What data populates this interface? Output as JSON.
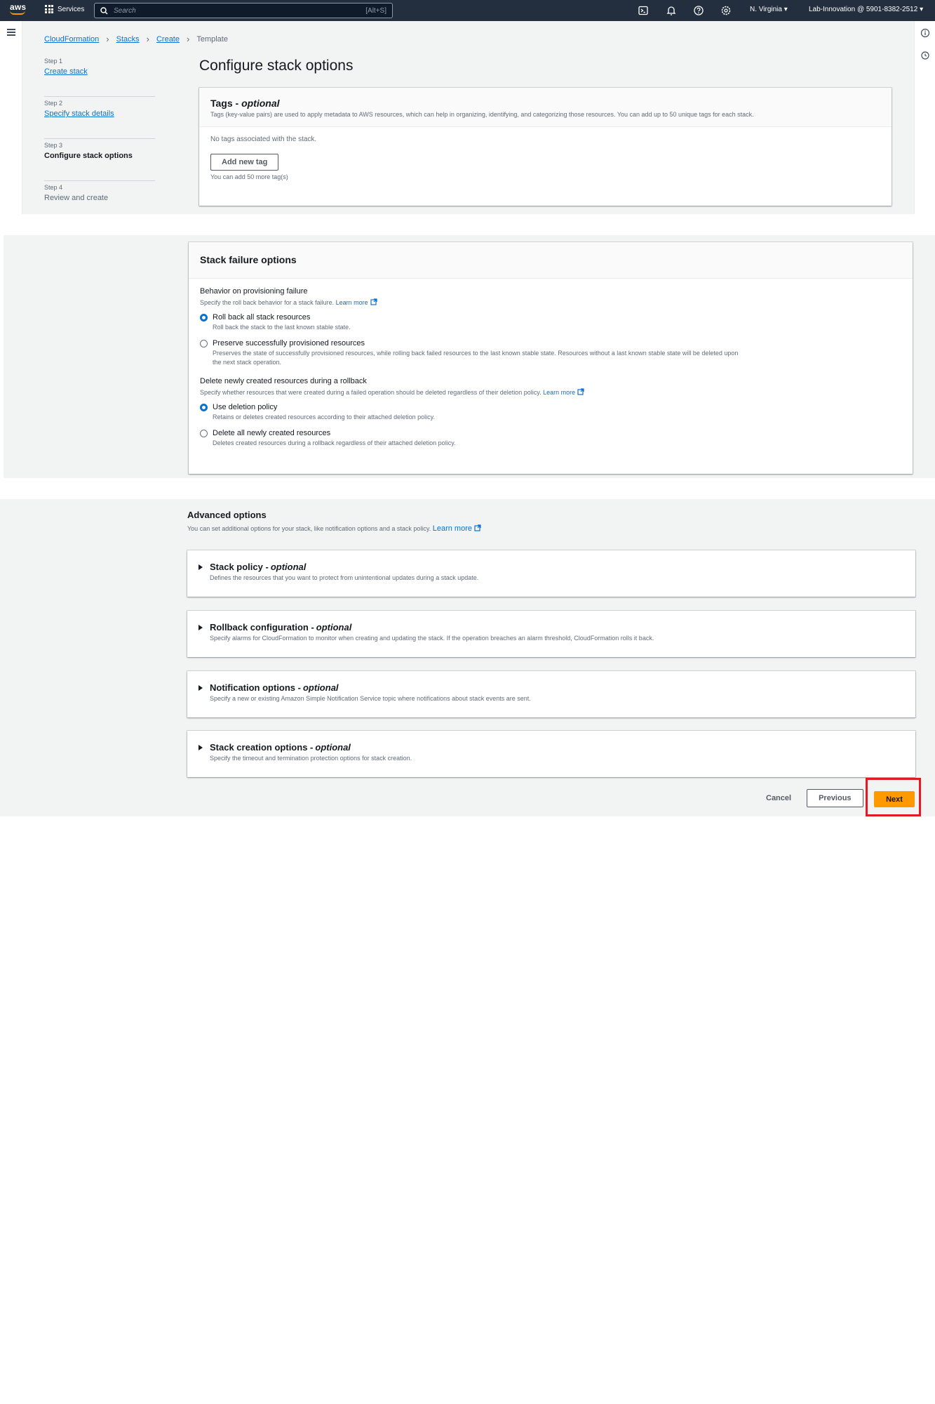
{
  "topnav": {
    "logo_text": "aws",
    "services_label": "Services",
    "search_placeholder": "Search",
    "search_shortcut": "[Alt+S]",
    "region": "N. Virginia",
    "account": "Lab-Innovation @ 5901-8382-2512"
  },
  "breadcrumbs": [
    "CloudFormation",
    "Stacks",
    "Create",
    "Template"
  ],
  "steps": [
    {
      "num": "Step 1",
      "label": "Create stack"
    },
    {
      "num": "Step 2",
      "label": "Specify stack details"
    },
    {
      "num": "Step 3",
      "label": "Configure stack options"
    },
    {
      "num": "Step 4",
      "label": "Review and create"
    }
  ],
  "page_title": "Configure stack options",
  "tags": {
    "title": "Tags - ",
    "title_suffix": "optional",
    "description": "Tags (key-value pairs) are used to apply metadata to AWS resources, which can help in organizing, identifying, and categorizing those resources. You can add up to 50 unique tags for each stack.",
    "empty_text": "No tags associated with the stack.",
    "add_button": "Add new tag",
    "hint": "You can add 50 more tag(s)"
  },
  "failure": {
    "title": "Stack failure options",
    "behavior_label": "Behavior on provisioning failure",
    "behavior_desc": "Specify the roll back behavior for a stack failure.",
    "learn_more": "Learn more",
    "opt1_label": "Roll back all stack resources",
    "opt1_desc": "Roll back the stack to the last known stable state.",
    "opt2_label": "Preserve successfully provisioned resources",
    "opt2_desc": "Preserves the state of successfully provisioned resources, while rolling back failed resources to the last known stable state. Resources without a last known stable state will be deleted upon the next stack operation.",
    "delete_label": "Delete newly created resources during a rollback",
    "delete_desc": "Specify whether resources that were created during a failed operation should be deleted regardless of their deletion policy.",
    "opt3_label": "Use deletion policy",
    "opt3_desc": "Retains or deletes created resources according to their attached deletion policy.",
    "opt4_label": "Delete all newly created resources",
    "opt4_desc": "Deletes created resources during a rollback regardless of their attached deletion policy."
  },
  "advanced": {
    "title": "Advanced options",
    "desc": "You can set additional options for your stack, like notification options and a stack policy.",
    "learn_more": "Learn more",
    "optional": "optional",
    "sections": [
      {
        "title": "Stack policy - ",
        "desc": "Defines the resources that you want to protect from unintentional updates during a stack update."
      },
      {
        "title": "Rollback configuration - ",
        "desc": "Specify alarms for CloudFormation to monitor when creating and updating the stack. If the operation breaches an alarm threshold, CloudFormation rolls it back."
      },
      {
        "title": "Notification options - ",
        "desc": "Specify a new or existing Amazon Simple Notification Service topic where notifications about stack events are sent."
      },
      {
        "title": "Stack creation options - ",
        "desc": "Specify the timeout and termination protection options for stack creation."
      }
    ]
  },
  "footer": {
    "cancel": "Cancel",
    "previous": "Previous",
    "next": "Next"
  },
  "colors": {
    "nav_bg": "#232f3e",
    "accent_orange": "#ff9900",
    "link_blue": "#0972d3",
    "highlight_red": "#e01b24"
  }
}
